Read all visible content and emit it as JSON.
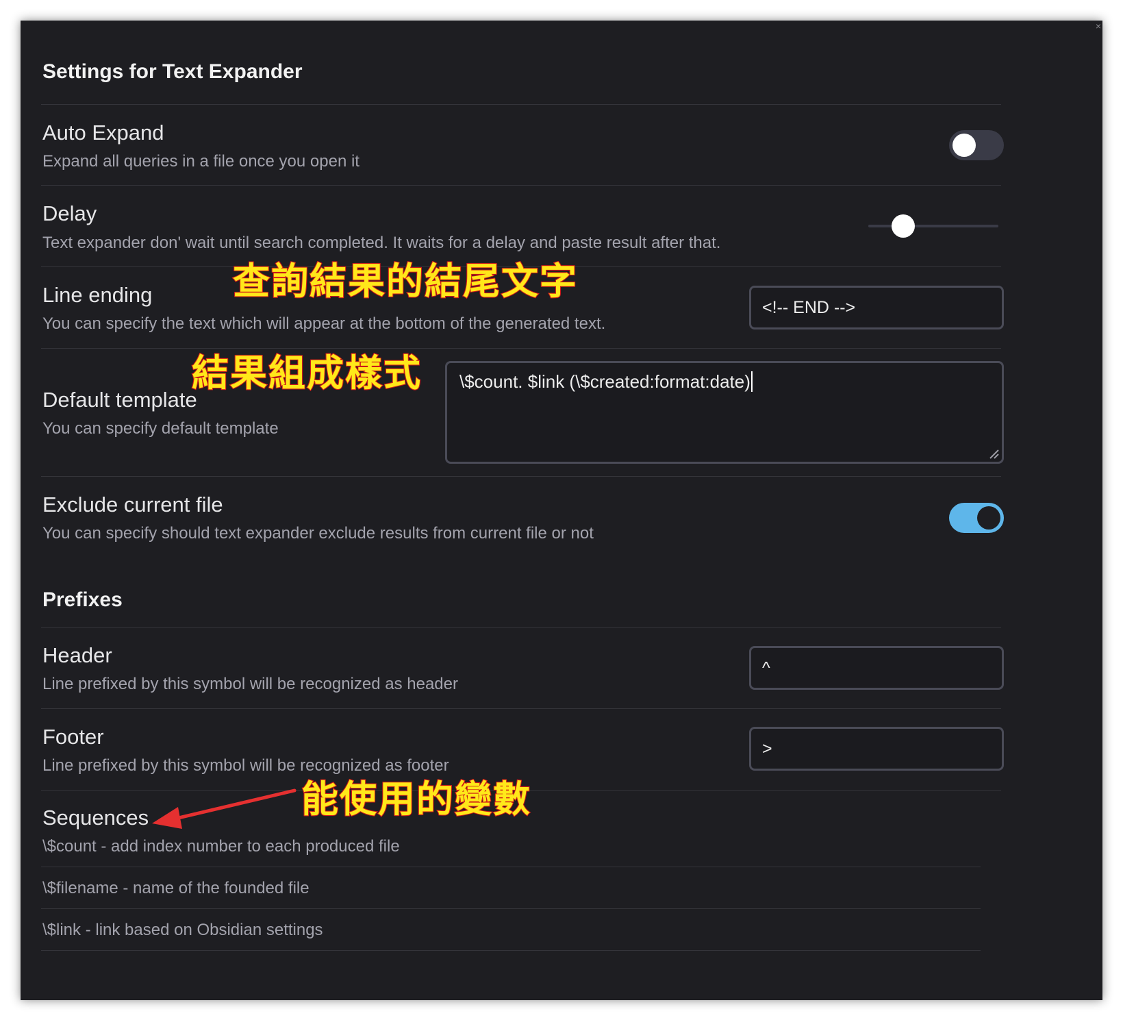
{
  "settings_title": "Settings for Text Expander",
  "auto_expand": {
    "name": "Auto Expand",
    "description": "Expand all queries in a file once you open it",
    "enabled": false
  },
  "delay": {
    "name": "Delay",
    "description": "Text expander don' wait until search completed. It waits for a delay and paste result after that.",
    "slider_fraction": 0.27
  },
  "line_ending": {
    "name": "Line ending",
    "description": "You can specify the text which will appear at the bottom of the generated text.",
    "value": "<!-- END -->"
  },
  "default_template": {
    "name": "Default template",
    "description": "You can specify default template",
    "value": "\\$count. $link  (\\$created:format:date)"
  },
  "exclude_current_file": {
    "name": "Exclude current file",
    "description": "You can specify should text expander exclude results from current file or not",
    "enabled": true
  },
  "prefixes_heading": "Prefixes",
  "header": {
    "name": "Header",
    "description": "Line prefixed by this symbol will be recognized as header",
    "value": "^"
  },
  "footer": {
    "name": "Footer",
    "description": "Line prefixed by this symbol will be recognized as footer",
    "value": ">"
  },
  "sequences": {
    "name": "Sequences",
    "items": [
      "\\$count - add index number to each produced file",
      "\\$filename - name of the founded file",
      "\\$link - link based on Obsidian settings"
    ]
  },
  "annotations": {
    "line_ending_note": "查詢結果的結尾文字",
    "template_note": "結果組成樣式",
    "sequences_note": "能使用的變數"
  },
  "colors": {
    "panel_bg": "#1e1e22",
    "accent_toggle": "#5eb6ea",
    "annotation_text": "#ffe81a",
    "annotation_outline": "#e02020",
    "arrow": "#e53030"
  }
}
